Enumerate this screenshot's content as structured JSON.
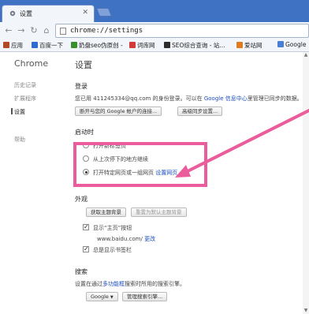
{
  "browser": {
    "tab_title": "设置",
    "tab_close": "✕",
    "address": "chrome://settings"
  },
  "bookmarks": [
    {
      "label": "应用",
      "color": "#b24a2a"
    },
    {
      "label": "百度一下",
      "color": "#2f6ad0"
    },
    {
      "label": "奶盘seo伪原创 -",
      "color": "#3a8f2d"
    },
    {
      "label": "词库网",
      "color": "#d33a3a"
    },
    {
      "label": "SEO综合查询 - 站...",
      "color": "#2c2c2c"
    },
    {
      "label": "爱站网",
      "color": "#e07b20"
    },
    {
      "label": "Google",
      "color": "#4a7fd8"
    }
  ],
  "sidenav": {
    "logo": "Chrome",
    "items": [
      "历史记录",
      "扩展程序",
      "设置",
      "帮助"
    ]
  },
  "main": {
    "title": "设置",
    "login": {
      "heading": "登录",
      "desc_prefix": "您已用 411245334@qq.com 的身份登录。可以在 ",
      "desc_link": "Google 信息中心",
      "desc_suffix": "里管理已同步的数据。",
      "btn_disconnect": "断开与您的 Google 帐户的连接...",
      "btn_advanced_sync": "高级同步设置..."
    },
    "startup": {
      "heading": "启动时",
      "opt_newtab": "打开新标签页",
      "opt_continue": "从上次停下的地方继续",
      "opt_specific": "打开特定网页或一组网页",
      "opt_specific_link": "设置网页"
    },
    "appearance": {
      "heading": "外观",
      "btn_get_themes": "获取主题背景",
      "btn_reset_theme": "重置为默认主题背景",
      "show_home": "显示“主页”按钮",
      "home_url": "www.baidu.com/",
      "home_change": "更改",
      "show_bookmarks": "总是显示书签栏"
    },
    "search": {
      "heading": "搜索",
      "desc_prefix": "设置在通过",
      "desc_link": "多功能框",
      "desc_suffix": "搜索时所用的搜索引擎。",
      "engine": "Google",
      "btn_manage": "管理搜索引擎..."
    }
  },
  "colors": {
    "annotation": "#ea5c9b",
    "link": "#1a4dbf"
  }
}
